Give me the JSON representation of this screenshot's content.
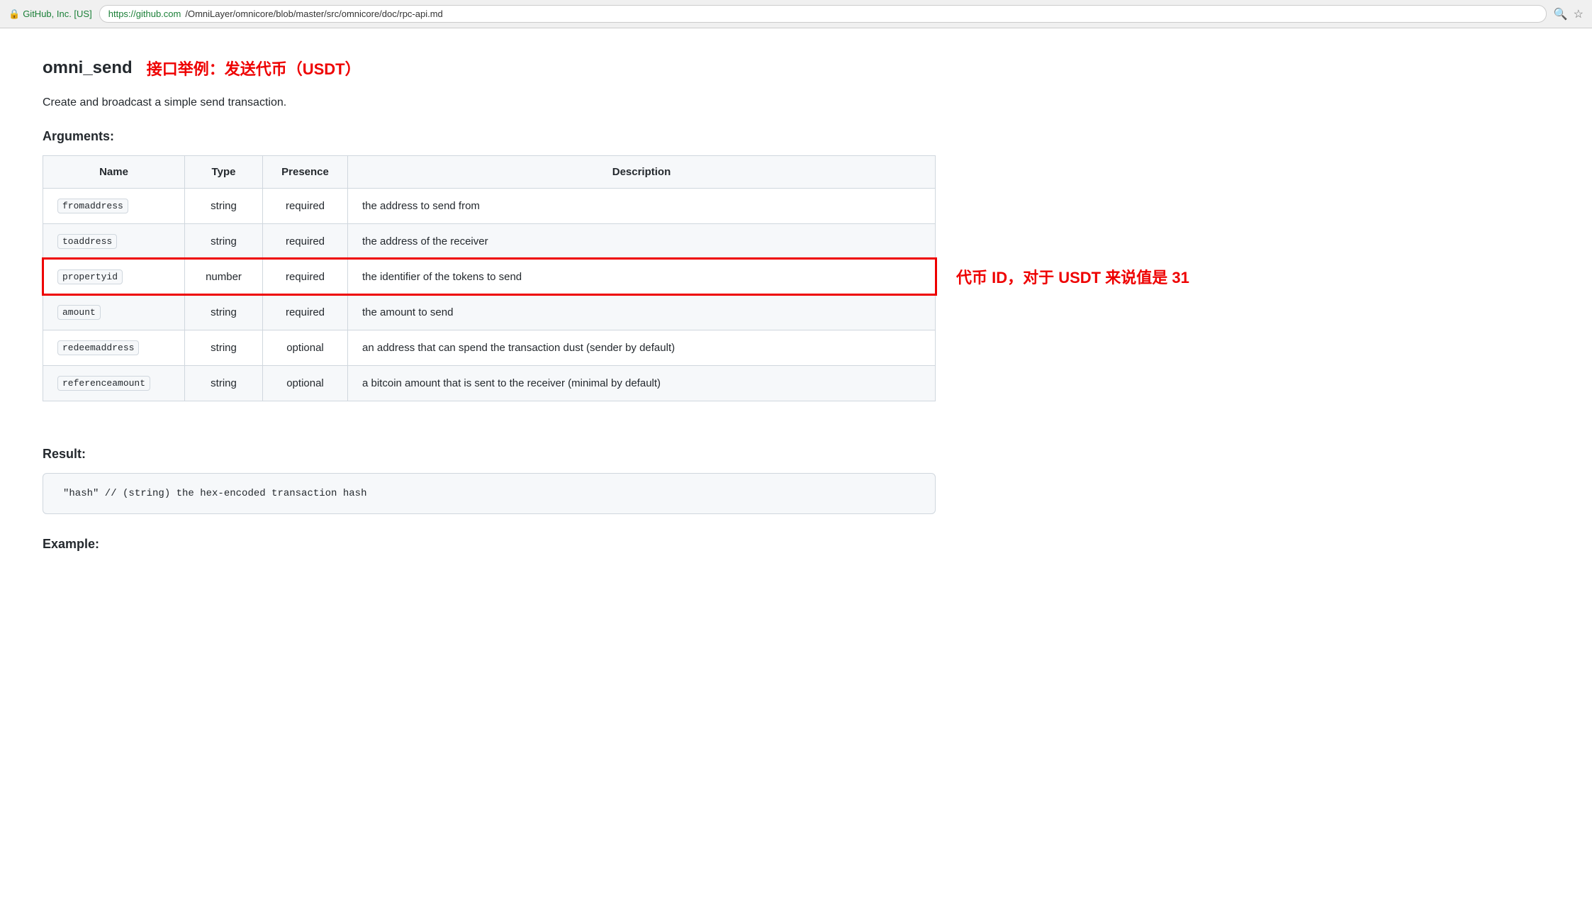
{
  "browser": {
    "lock_label": "GitHub, Inc. [US]",
    "url_green": "https://github.com",
    "url_rest": "/OmniLayer/omnicore/blob/master/src/omnicore/doc/rpc-api.md"
  },
  "page": {
    "heading_main": "omni_send",
    "heading_annotation": "接口举例：发送代币（USDT）",
    "description": "Create and broadcast a simple send transaction.",
    "arguments_label": "Arguments:",
    "result_label": "Result:",
    "example_label": "Example:",
    "table": {
      "headers": [
        "Name",
        "Type",
        "Presence",
        "Description"
      ],
      "rows": [
        {
          "name": "fromaddress",
          "type": "string",
          "presence": "required",
          "description": "the address to send from",
          "highlighted": false
        },
        {
          "name": "toaddress",
          "type": "string",
          "presence": "required",
          "description": "the address of the receiver",
          "highlighted": false
        },
        {
          "name": "propertyid",
          "type": "number",
          "presence": "required",
          "description": "the identifier of the tokens to send",
          "highlighted": true
        },
        {
          "name": "amount",
          "type": "string",
          "presence": "required",
          "description": "the amount to send",
          "highlighted": false
        },
        {
          "name": "redeemaddress",
          "type": "string",
          "presence": "optional",
          "description": "an address that can spend the transaction dust (sender by default)",
          "highlighted": false
        },
        {
          "name": "referenceamount",
          "type": "string",
          "presence": "optional",
          "description": "a bitcoin amount that is sent to the receiver (minimal by default)",
          "highlighted": false
        }
      ]
    },
    "result_code": "\"hash\"  // (string) the hex-encoded transaction hash",
    "row_annotation": "代币 ID，对于 USDT 来说值是 31"
  }
}
